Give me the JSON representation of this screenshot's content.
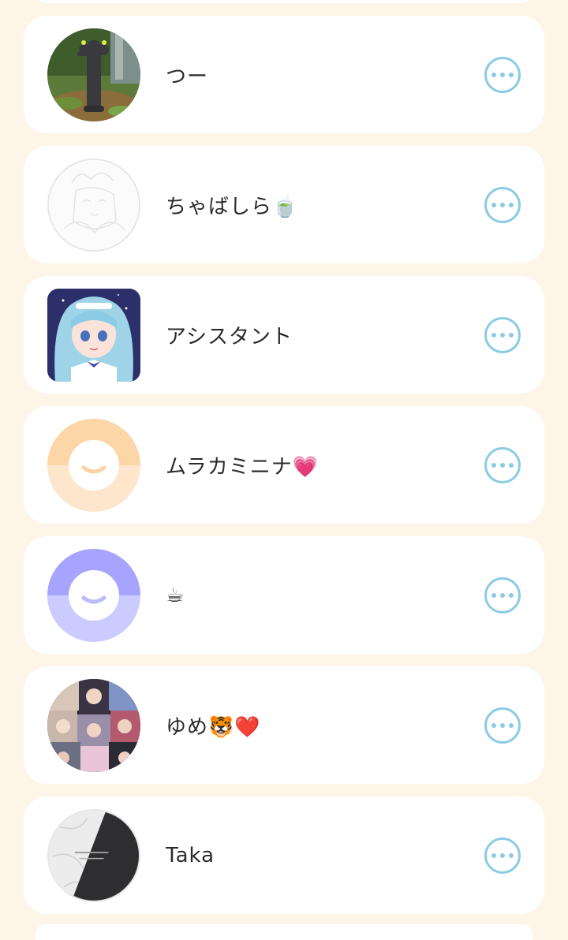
{
  "friends": [
    {
      "name": "つー",
      "avatar": "forest-creature-photo"
    },
    {
      "name": "ちゃばしら🍵",
      "avatar": "sketch-drawing"
    },
    {
      "name": "アシスタント",
      "avatar": "anime-maid-girl"
    },
    {
      "name": "ムラカミニナ💗",
      "avatar": "default-face-orange"
    },
    {
      "name": "☕",
      "avatar": "default-face-purple"
    },
    {
      "name": "ゆめ🐯❤️",
      "avatar": "photo-collage"
    },
    {
      "name": "Taka",
      "avatar": "marble-logo"
    }
  ],
  "more_icon": "ellipsis-circle-icon",
  "colors": {
    "background": "#fdf6e8",
    "card": "#ffffff",
    "accent": "#8ccbe4",
    "text": "#2a2a2a"
  }
}
